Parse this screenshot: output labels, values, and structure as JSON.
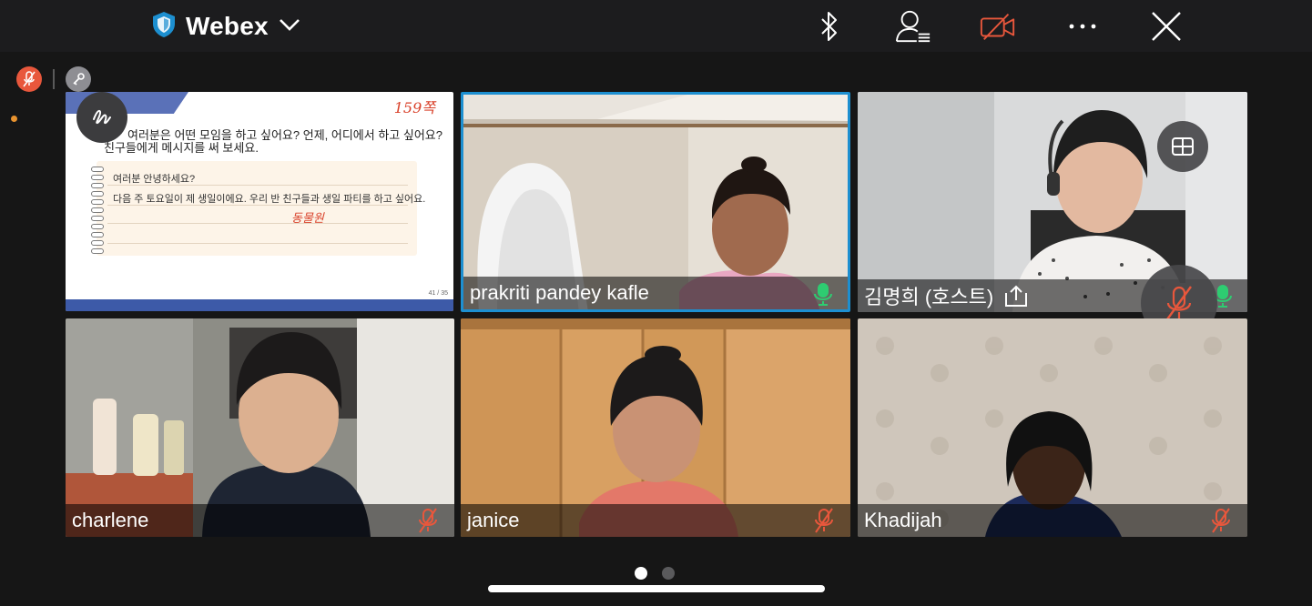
{
  "app": {
    "title": "Webex"
  },
  "colors": {
    "accent": "#1d8fd0",
    "muted": "#e8573c",
    "mic_on": "#2ecc71",
    "mic_off": "#e8573c"
  },
  "top_icons": [
    "bluetooth-icon",
    "participants-icon",
    "video-off-icon",
    "more-icon",
    "close-icon"
  ],
  "share": {
    "page_annotation": "159쪽",
    "question_line1": "여러분은 어떤 모임을 하고 싶어요? 언제, 어디에서 하고 싶어요?",
    "question_line2": "친구들에게 메시지를 써 보세요.",
    "note_line1": "여러분 안녕하세요?",
    "note_line2": "다음 주 토요일이 제 생일이에요. 우리 반 친구들과 생일 파티를 하고 싶어요.",
    "handwritten": "동물원",
    "page_number": "41 / 35"
  },
  "participants": [
    {
      "name": "prakriti pandey kafle",
      "mic": "on",
      "active_speaker": true
    },
    {
      "name": "김명희 (호스트)",
      "mic": "on",
      "sharing": true
    },
    {
      "name": "charlene",
      "mic": "muted"
    },
    {
      "name": "janice",
      "mic": "muted"
    },
    {
      "name": "Khadijah",
      "mic": "muted"
    }
  ],
  "pager": {
    "pages": 2,
    "current": 1
  }
}
